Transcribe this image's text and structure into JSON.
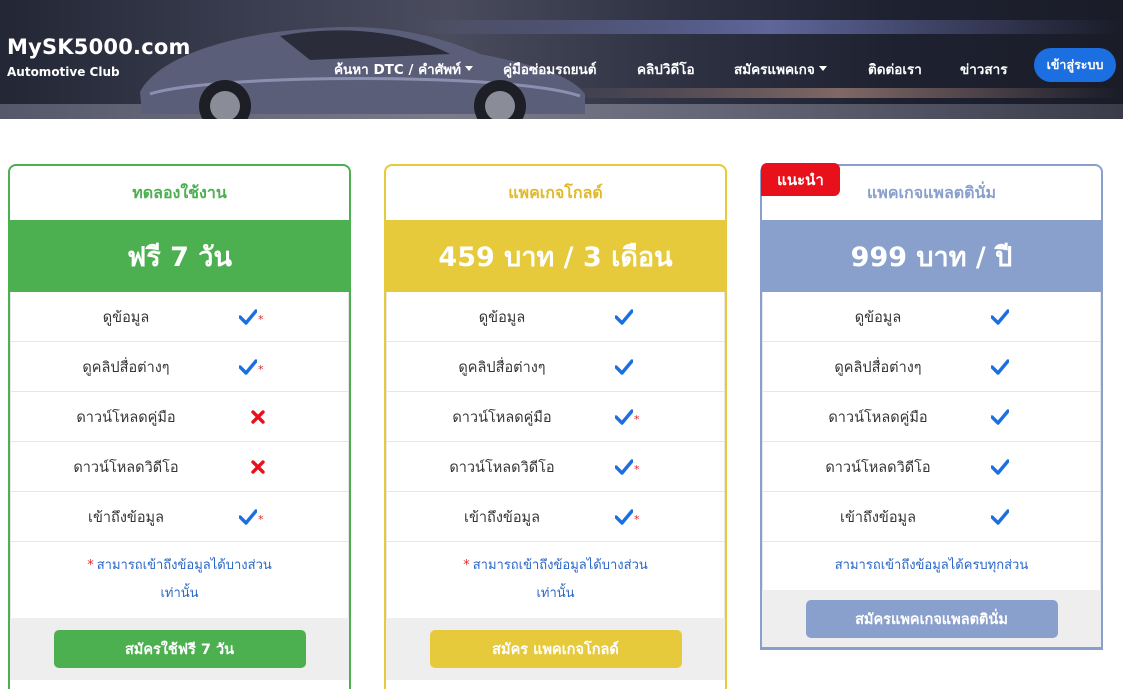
{
  "header": {
    "brand_title": "MySK5000.com",
    "brand_subtitle": "Automotive Club",
    "nav": [
      {
        "label": "ค้นหา DTC / คำศัพท์",
        "dropdown": true
      },
      {
        "label": "คู่มือซ่อมรถยนต์",
        "dropdown": false
      },
      {
        "label": "คลิปวิดีโอ",
        "dropdown": false
      },
      {
        "label": "สมัครแพคเกจ",
        "dropdown": true
      },
      {
        "label": "ติดต่อเรา",
        "dropdown": false
      },
      {
        "label": "ข่าวสาร",
        "dropdown": false
      }
    ],
    "login_label": "เข้าสู่ระบบ"
  },
  "colors": {
    "trial": "#4caf50",
    "gold": "#e7c93c",
    "platinum": "#8aa0cc",
    "check": "#1c6fe0",
    "cross": "#e8101a",
    "ribbon": "#e8101a"
  },
  "plans": [
    {
      "name": "ทดลองใช้งาน",
      "price": "ฟรี 7 วัน",
      "features": [
        {
          "label": "ดูข้อมูล",
          "status": "check",
          "partial": true
        },
        {
          "label": "ดูคลิปสื่อต่างๆ",
          "status": "check",
          "partial": true
        },
        {
          "label": "ดาวน์โหลดคู่มือ",
          "status": "cross",
          "partial": false
        },
        {
          "label": "ดาวน์โหลดวิดีโอ",
          "status": "cross",
          "partial": false
        },
        {
          "label": "เข้าถึงข้อมูล",
          "status": "check",
          "partial": true
        }
      ],
      "note_star": "*",
      "note_line1": "สามารถเข้าถึงข้อมูลได้บางส่วน",
      "note_line2": "เท่านั้น",
      "button": "สมัครใช้ฟรี 7 วัน"
    },
    {
      "name": "แพคเกจโกลด์",
      "price": "459 บาท / 3 เดือน",
      "features": [
        {
          "label": "ดูข้อมูล",
          "status": "check",
          "partial": false
        },
        {
          "label": "ดูคลิปสื่อต่างๆ",
          "status": "check",
          "partial": false
        },
        {
          "label": "ดาวน์โหลดคู่มือ",
          "status": "check",
          "partial": true
        },
        {
          "label": "ดาวน์โหลดวิดีโอ",
          "status": "check",
          "partial": true
        },
        {
          "label": "เข้าถึงข้อมูล",
          "status": "check",
          "partial": true
        }
      ],
      "note_star": "*",
      "note_line1": "สามารถเข้าถึงข้อมูลได้บางส่วน",
      "note_line2": "เท่านั้น",
      "button": "สมัคร แพคเกจโกลด์"
    },
    {
      "name": "แพคเกจแพลตตินั่ม",
      "price": "999 บาท / ปี",
      "badge": "แนะนำ",
      "features": [
        {
          "label": "ดูข้อมูล",
          "status": "check",
          "partial": false
        },
        {
          "label": "ดูคลิปสื่อต่างๆ",
          "status": "check",
          "partial": false
        },
        {
          "label": "ดาวน์โหลดคู่มือ",
          "status": "check",
          "partial": false
        },
        {
          "label": "ดาวน์โหลดวิดีโอ",
          "status": "check",
          "partial": false
        },
        {
          "label": "เข้าถึงข้อมูล",
          "status": "check",
          "partial": false
        }
      ],
      "note_line1": "สามารถเข้าถึงข้อมูลได้ครบทุกส่วน",
      "button": "สมัครแพคเกจแพลตตินั่ม"
    }
  ]
}
